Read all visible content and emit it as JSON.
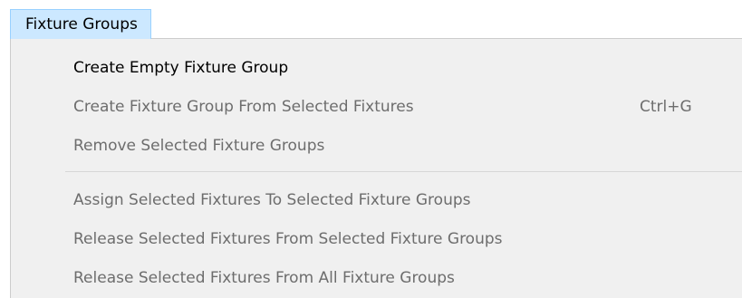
{
  "menubar": {
    "title": "Fixture Groups"
  },
  "menu": {
    "items": [
      {
        "label": "Create Empty Fixture Group",
        "shortcut": "",
        "enabled": true
      },
      {
        "label": "Create Fixture Group From Selected Fixtures",
        "shortcut": "Ctrl+G",
        "enabled": false
      },
      {
        "label": "Remove Selected Fixture Groups",
        "shortcut": "",
        "enabled": false
      },
      {
        "label": "Assign Selected Fixtures To Selected Fixture Groups",
        "shortcut": "",
        "enabled": false
      },
      {
        "label": "Release Selected Fixtures From Selected Fixture Groups",
        "shortcut": "",
        "enabled": false
      },
      {
        "label": "Release Selected Fixtures From All Fixture Groups",
        "shortcut": "",
        "enabled": false
      }
    ]
  },
  "colors": {
    "menu_background": "#f0f0f0",
    "active_tab_background": "#cce8ff",
    "active_tab_border": "#99d1ff",
    "enabled_text": "#000000",
    "disabled_text": "#6d6d6d"
  }
}
